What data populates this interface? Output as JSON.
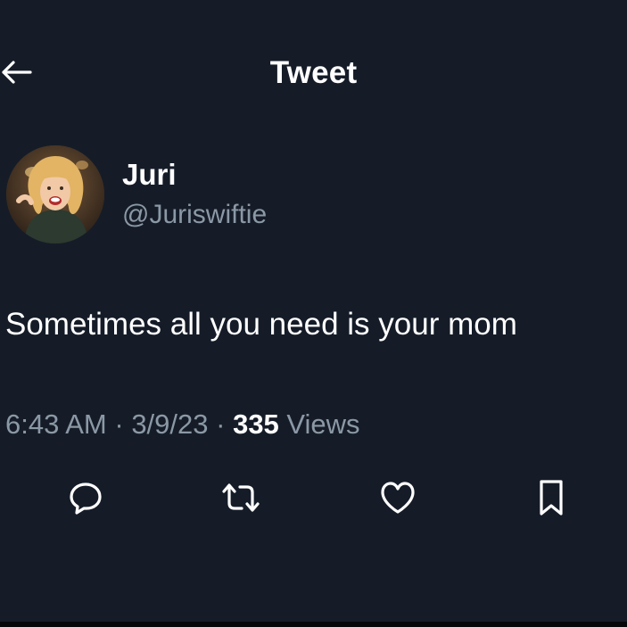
{
  "header": {
    "title": "Tweet",
    "back_icon": "arrow-left-icon"
  },
  "author": {
    "display_name": "Juri",
    "handle": "@Juriswiftie"
  },
  "tweet": {
    "text": "Sometimes all you need is your mom"
  },
  "meta": {
    "time": "6:43 AM",
    "sep1": " · ",
    "date": "3/9/23",
    "sep2": " · ",
    "views_count": "335",
    "views_label": " Views"
  },
  "actions": [
    {
      "icon": "reply-icon"
    },
    {
      "icon": "retweet-icon"
    },
    {
      "icon": "like-icon"
    },
    {
      "icon": "bookmark-icon"
    }
  ],
  "colors": {
    "background": "#151c28",
    "text": "#ffffff",
    "secondary_text": "#8b98a5"
  }
}
